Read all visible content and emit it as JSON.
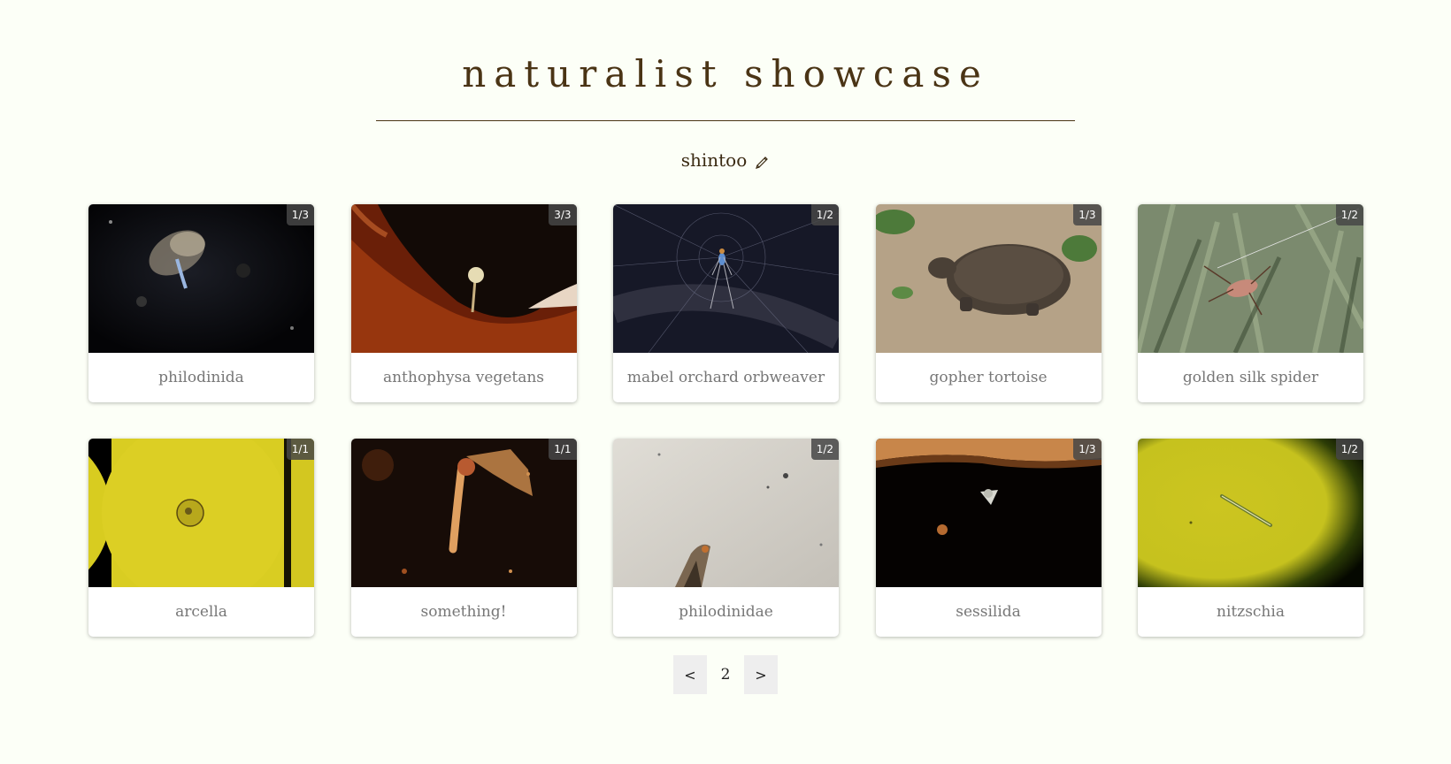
{
  "header": {
    "title": "naturalist showcase",
    "username": "shintoo",
    "edit_icon": "pencil-icon"
  },
  "observations": [
    {
      "caption": "philodinida",
      "badge": "1/3"
    },
    {
      "caption": "anthophysa vegetans",
      "badge": "3/3"
    },
    {
      "caption": "mabel orchard orbweaver",
      "badge": "1/2"
    },
    {
      "caption": "gopher tortoise",
      "badge": "1/3"
    },
    {
      "caption": "golden silk spider",
      "badge": "1/2"
    },
    {
      "caption": "arcella",
      "badge": "1/1"
    },
    {
      "caption": "something!",
      "badge": "1/1"
    },
    {
      "caption": "philodinidae",
      "badge": "1/2"
    },
    {
      "caption": "sessilida",
      "badge": "1/3"
    },
    {
      "caption": "nitzschia",
      "badge": "1/2"
    }
  ],
  "pagination": {
    "prev_label": "<",
    "page": "2",
    "next_label": ">"
  },
  "colors": {
    "background": "#fcfff7",
    "title": "#4a3415",
    "caption": "#777777"
  }
}
